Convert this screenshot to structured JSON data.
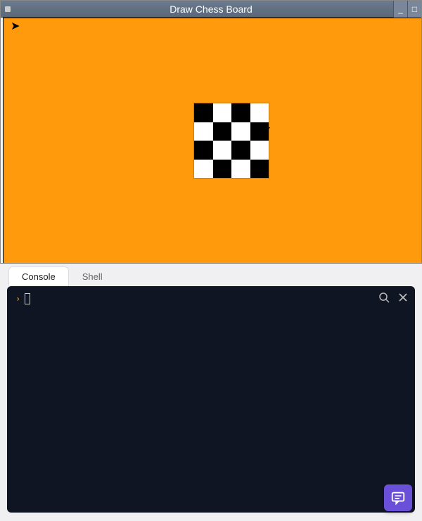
{
  "window": {
    "title": "Draw Chess Board"
  },
  "canvas": {
    "bg_color": "#ff9a0d",
    "board": {
      "rows": 4,
      "cols": 4,
      "colors": {
        "dark": "#000000",
        "light": "#ffffff"
      }
    }
  },
  "tabs": {
    "items": [
      {
        "label": "Console",
        "active": true
      },
      {
        "label": "Shell",
        "active": false
      }
    ]
  },
  "console": {
    "prompt_symbol": "›",
    "output": ""
  },
  "icons": {
    "search": "search-icon",
    "close": "close-icon",
    "chat": "chat-icon",
    "minimize": "_",
    "maximize": "□"
  }
}
